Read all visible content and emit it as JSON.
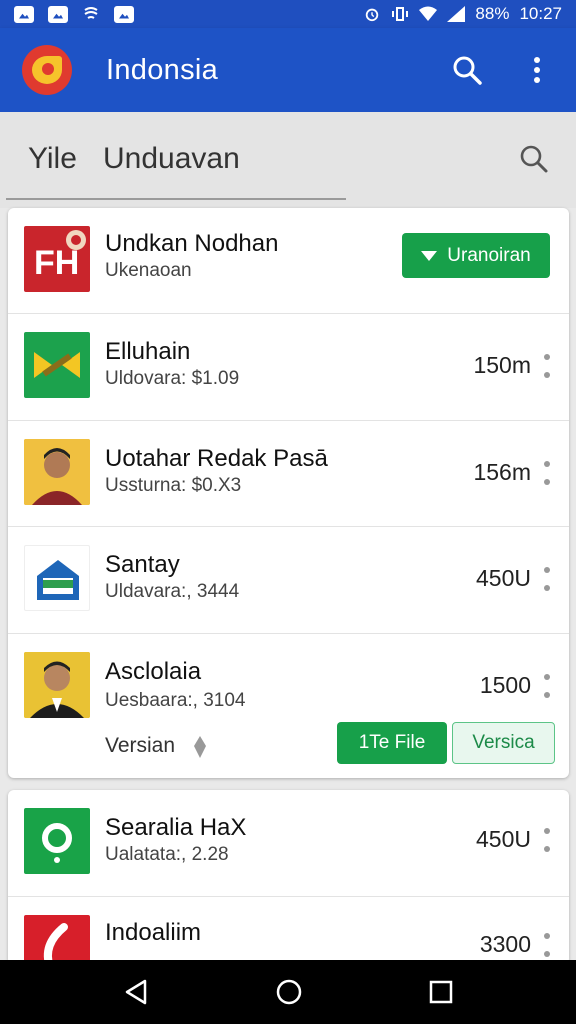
{
  "status_bar": {
    "battery": "88%",
    "time": "10:27"
  },
  "app_bar": {
    "title": "Indonsia",
    "icons": [
      "search-icon",
      "more-vert-icon"
    ]
  },
  "tabs": {
    "tab_a": "Yile",
    "tab_b": "Unduavan"
  },
  "list": [
    {
      "name": "Undkan Nodhan",
      "sub": "Ukenaoan",
      "action": "Uranoiran",
      "thumb": "fh-app-icon"
    },
    {
      "name": "Elluhain",
      "sub": "Uldovara: $1.09",
      "size": "150m",
      "thumb": "x-app-icon"
    },
    {
      "name": "Uotahar Redak Pasā",
      "sub": "Ussturna: $0.X3",
      "size": "156m",
      "thumb": "person-avatar"
    },
    {
      "name": "Santay",
      "sub": "Uldavara:, 3444",
      "size": "450U",
      "thumb": "house-app-icon"
    },
    {
      "name": "Asclolaia",
      "sub": "Uesbaara:, 3104",
      "size": "1500",
      "thumb": "person-avatar-2",
      "version_label": "Versian",
      "btn_file": "1Te File",
      "btn_version": "Versica"
    },
    {
      "name": "Searalia HaX",
      "sub": "Ualatata:, 2.28",
      "size": "450U",
      "thumb": "green-app-icon"
    },
    {
      "name": "Indoaliim",
      "sub": "",
      "size": "3300",
      "thumb": "red-app-icon"
    }
  ],
  "colors": {
    "primary": "#1e53c6",
    "green": "#17a04a",
    "red": "#d71f2a"
  }
}
